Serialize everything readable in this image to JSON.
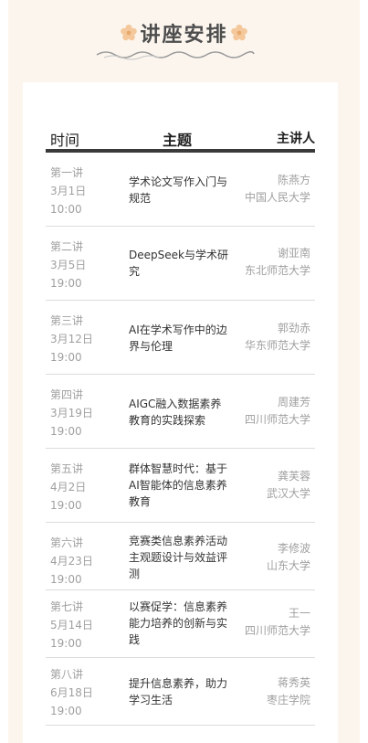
{
  "title": "讲座安排",
  "colors": {
    "background": "#fbf5ee",
    "card": "#ffffff",
    "flower": "#f4c89a",
    "header_bar": "#3a3a3a",
    "muted_text": "#a0a0a0"
  },
  "icons": {
    "left": "flower-icon",
    "right": "flower-icon",
    "underline": "wavy-line-icon"
  },
  "table": {
    "headers": {
      "time": "时间",
      "topic": "主题",
      "speaker": "主讲人"
    },
    "rows": [
      {
        "lecture": "第一讲",
        "date": "3月1日",
        "time": "10:00",
        "topic": "学术论文写作入门与规范",
        "speaker": "陈燕方",
        "affiliation": "中国人民大学"
      },
      {
        "lecture": "第二讲",
        "date": "3月5日",
        "time": "19:00",
        "topic": "DeepSeek与学术研究",
        "speaker": "谢亚南",
        "affiliation": "东北师范大学"
      },
      {
        "lecture": "第三讲",
        "date": "3月12日",
        "time": "19:00",
        "topic": "AI在学术写作中的边界与伦理",
        "speaker": "郭劲赤",
        "affiliation": "华东师范大学"
      },
      {
        "lecture": "第四讲",
        "date": "3月19日",
        "time": "19:00",
        "topic": "AIGC融入数据素养教育的实践探索",
        "speaker": "周建芳",
        "affiliation": "四川师范大学"
      },
      {
        "lecture": "第五讲",
        "date": "4月2日",
        "time": "19:00",
        "topic": "群体智慧时代：基于AI智能体的信息素养教育",
        "speaker": "龚芙蓉",
        "affiliation": "武汉大学"
      },
      {
        "lecture": "第六讲",
        "date": "4月23日",
        "time": "19:00",
        "topic": "竞赛类信息素养活动主观题设计与效益评测",
        "speaker": "李修波",
        "affiliation": "山东大学"
      },
      {
        "lecture": "第七讲",
        "date": "5月14日",
        "time": "19:00",
        "topic": "以赛促学：信息素养能力培养的创新与实践",
        "speaker": "王一",
        "affiliation": "四川师范大学"
      },
      {
        "lecture": "第八讲",
        "date": "6月18日",
        "time": "19:00",
        "topic": "提升信息素养，助力学习生活",
        "speaker": "蒋秀英",
        "affiliation": "枣庄学院"
      }
    ]
  }
}
